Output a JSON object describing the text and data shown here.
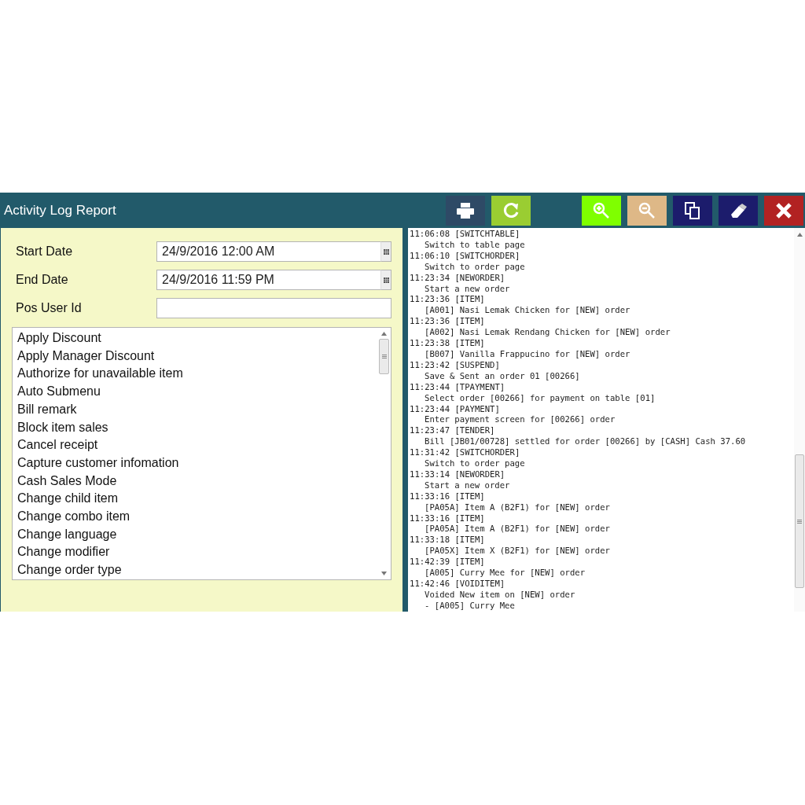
{
  "window": {
    "title": "Activity Log Report"
  },
  "toolbar": [
    {
      "kind": "print"
    },
    {
      "kind": "refresh"
    },
    {
      "kind": "zoom-in"
    },
    {
      "kind": "zoom-out"
    },
    {
      "kind": "copy"
    },
    {
      "kind": "erase"
    },
    {
      "kind": "close"
    }
  ],
  "form": [
    {
      "label": "Start Date",
      "value": "24/9/2016 12:00 AM",
      "kind": "date"
    },
    {
      "label": "End Date",
      "value": "24/9/2016 11:59 PM",
      "kind": "date"
    },
    {
      "label": "Pos User Id",
      "kind": "text"
    }
  ],
  "activities": [
    "Apply Discount",
    "Apply Manager Discount",
    "Authorize for unavailable item",
    "Auto Submenu",
    "Bill remark",
    "Block item sales",
    "Cancel receipt",
    "Capture customer infomation",
    "Cash Sales Mode",
    "Change child item",
    "Change combo item",
    "Change language",
    "Change modifier",
    "Change order type"
  ],
  "log": [
    {
      "header": "11:06:08 [SWITCHTABLE]",
      "details": [
        "Switch to table page"
      ]
    },
    {
      "header": "11:06:10 [SWITCHORDER]",
      "details": [
        "Switch to order page"
      ]
    },
    {
      "header": "11:23:34 [NEWORDER]",
      "details": [
        "Start a new order"
      ]
    },
    {
      "header": "11:23:36 [ITEM]",
      "details": [
        "[A001] Nasi Lemak Chicken for [NEW] order"
      ]
    },
    {
      "header": "11:23:36 [ITEM]",
      "details": [
        "[A002] Nasi Lemak Rendang Chicken for [NEW] order"
      ]
    },
    {
      "header": "11:23:38 [ITEM]",
      "details": [
        "[B007] Vanilla Frappucino for [NEW] order"
      ]
    },
    {
      "header": "11:23:42 [SUSPEND]",
      "details": [
        "Save & Sent an order 01 [00266]"
      ]
    },
    {
      "header": "11:23:44 [TPAYMENT]",
      "details": [
        "Select order [00266] for payment on table [01]"
      ]
    },
    {
      "header": "11:23:44 [PAYMENT]",
      "details": [
        "Enter payment screen for [00266] order"
      ]
    },
    {
      "header": "11:23:47 [TENDER]",
      "details": [
        "Bill [JB01/00728] settled for order [00266] by [CASH] Cash 37.60"
      ]
    },
    {
      "header": "11:31:42 [SWITCHORDER]",
      "details": [
        "Switch to order page"
      ]
    },
    {
      "header": "11:33:14 [NEWORDER]",
      "details": [
        "Start a new order"
      ]
    },
    {
      "header": "11:33:16 [ITEM]",
      "details": [
        "[PA05A] Item A (B2F1) for [NEW] order"
      ]
    },
    {
      "header": "11:33:16 [ITEM]",
      "details": [
        "[PA05A] Item A (B2F1) for [NEW] order"
      ]
    },
    {
      "header": "11:33:18 [ITEM]",
      "details": [
        "[PA05X] Item X (B2F1) for [NEW] order"
      ]
    },
    {
      "header": "11:42:39 [ITEM]",
      "details": [
        "[A005] Curry Mee for [NEW] order"
      ]
    },
    {
      "header": "11:42:46 [VOIDITEM]",
      "details": [
        "Voided New item on [NEW] order",
        "- [A005] Curry Mee"
      ]
    }
  ]
}
